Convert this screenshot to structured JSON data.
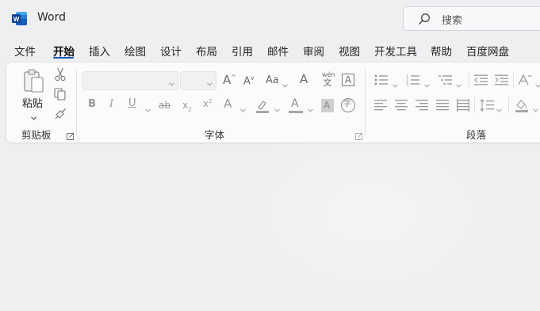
{
  "app": {
    "title": "Word",
    "logo_letter": "W"
  },
  "search": {
    "placeholder": "搜索"
  },
  "tabs": [
    {
      "label": "文件"
    },
    {
      "label": "开始"
    },
    {
      "label": "插入"
    },
    {
      "label": "绘图"
    },
    {
      "label": "设计"
    },
    {
      "label": "布局"
    },
    {
      "label": "引用"
    },
    {
      "label": "邮件"
    },
    {
      "label": "审阅"
    },
    {
      "label": "视图"
    },
    {
      "label": "开发工具"
    },
    {
      "label": "帮助"
    },
    {
      "label": "百度网盘"
    }
  ],
  "active_tab": "开始",
  "ribbon": {
    "clipboard": {
      "label": "剪贴板",
      "paste_label": "粘贴"
    },
    "font": {
      "label": "字体",
      "font_name": "",
      "font_size": "",
      "glyphs": {
        "bold": "B",
        "italic": "I",
        "underline": "U",
        "strike": "ab",
        "sub": "x",
        "sup": "x",
        "grow": "A",
        "shrink": "A",
        "case": "Aa",
        "clear": "A",
        "phonetic_top": "wén",
        "phonetic_bottom": "文",
        "border_char": "A",
        "effects": "A",
        "highlight": "",
        "font_color": "A",
        "shading": "A",
        "enclose": "字"
      }
    },
    "paragraph": {
      "label": "段落"
    }
  },
  "colors": {
    "accent": "#185abd",
    "word_blue": "#185abd",
    "highlight_bar": "#a6a6a6",
    "font_color_bar": "#a6a6a6",
    "background": "#edeff1",
    "ribbon_bg": "#fbfbfc"
  }
}
